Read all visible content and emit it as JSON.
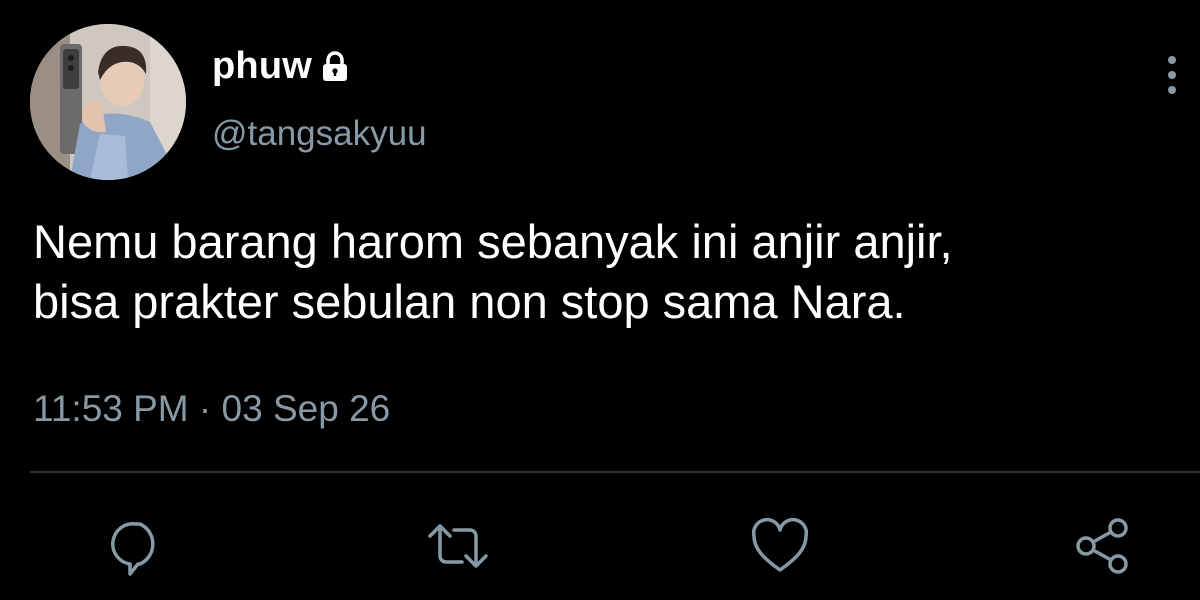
{
  "user": {
    "display_name": "phuw",
    "handle": "@tangsakyuu",
    "protected": true
  },
  "tweet": {
    "text": "Nemu barang harom sebanyak ini anjir anjir,\nbisa prakter sebulan non stop sama Nara.",
    "time": "11:53 PM",
    "separator": " · ",
    "date": "03 Sep 26"
  },
  "actions": [
    {
      "icon": "reply-icon"
    },
    {
      "icon": "retweet-icon"
    },
    {
      "icon": "like-icon"
    },
    {
      "icon": "share-icon"
    }
  ],
  "colors": {
    "background": "#000000",
    "text_primary": "#ffffff",
    "text_secondary": "#8899a6",
    "divider": "#2f3336"
  }
}
